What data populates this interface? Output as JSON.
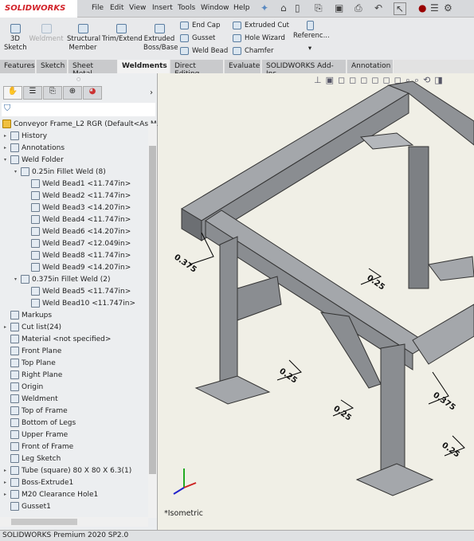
{
  "app": {
    "logo": "SOLIDWORKS",
    "status": "SOLIDWORKS Premium 2020 SP2.0"
  },
  "menu": [
    "File",
    "Edit",
    "View",
    "Insert",
    "Tools",
    "Window",
    "Help"
  ],
  "ribbon": {
    "sketch3d": "3D Sketch",
    "weldment": "Weldment",
    "structural": "Structural Member",
    "trim": "Trim/Extend",
    "extruded": "Extruded Boss/Base",
    "endcap": "End Cap",
    "gusset": "Gusset",
    "weldbead": "Weld Bead",
    "extcut": "Extruded Cut",
    "holewizard": "Hole Wizard",
    "chamfer": "Chamfer",
    "reference": "Referenc..."
  },
  "tabs": [
    {
      "label": "Features"
    },
    {
      "label": "Sketch"
    },
    {
      "label": "Sheet Metal"
    },
    {
      "label": "Weldments",
      "active": true
    },
    {
      "label": "Direct Editing"
    },
    {
      "label": "Evaluate"
    },
    {
      "label": "SOLIDWORKS Add-Ins"
    },
    {
      "label": "Annotation"
    }
  ],
  "tree": [
    {
      "label": "Conveyor Frame_L2 RGR  (Default<As M..."
    },
    {
      "label": "History"
    },
    {
      "label": "Annotations"
    },
    {
      "label": "Weld Folder"
    },
    {
      "label": "0.25in Fillet Weld (8)"
    },
    {
      "label": "Weld Bead1 <11.747in>"
    },
    {
      "label": "Weld Bead2 <11.747in>"
    },
    {
      "label": "Weld Bead3 <14.207in>"
    },
    {
      "label": "Weld Bead4 <11.747in>"
    },
    {
      "label": "Weld Bead6 <14.207in>"
    },
    {
      "label": "Weld Bead7 <12.049in>"
    },
    {
      "label": "Weld Bead8 <11.747in>"
    },
    {
      "label": "Weld Bead9 <14.207in>"
    },
    {
      "label": "0.375in Fillet Weld (2)"
    },
    {
      "label": "Weld Bead5 <11.747in>"
    },
    {
      "label": "Weld Bead10 <11.747in>"
    },
    {
      "label": "Markups"
    },
    {
      "label": "Cut list(24)"
    },
    {
      "label": "Material <not specified>"
    },
    {
      "label": "Front Plane"
    },
    {
      "label": "Top Plane"
    },
    {
      "label": "Right Plane"
    },
    {
      "label": "Origin"
    },
    {
      "label": "Weldment"
    },
    {
      "label": "Top of Frame"
    },
    {
      "label": "Bottom of Legs"
    },
    {
      "label": "Upper Frame"
    },
    {
      "label": "Front of Frame"
    },
    {
      "label": "Leg Sketch"
    },
    {
      "label": "Tube (square) 80 X 80 X 6.3(1)"
    },
    {
      "label": "Boss-Extrude1"
    },
    {
      "label": "M20 Clearance Hole1"
    },
    {
      "label": "Gusset1"
    }
  ],
  "viewport": {
    "view_label": "*Isometric",
    "weld_dims": [
      "0.375",
      "0.25",
      "0.25",
      "0.375",
      "0.25",
      "0.25"
    ]
  }
}
